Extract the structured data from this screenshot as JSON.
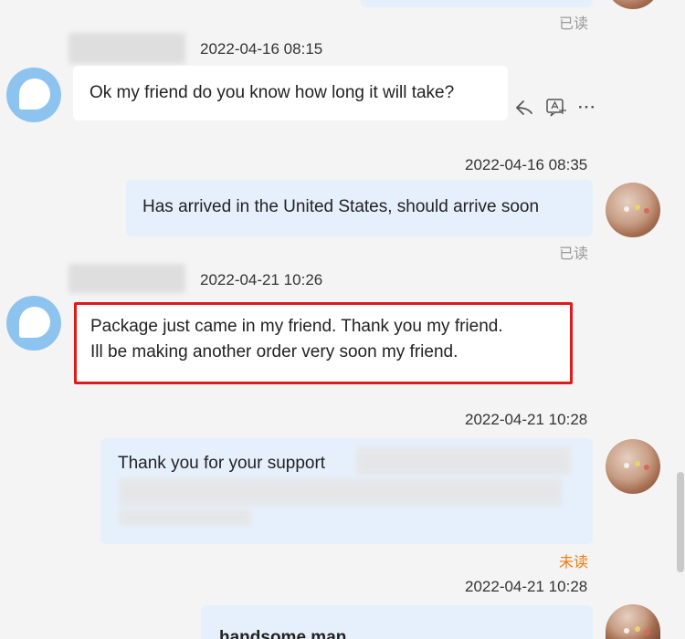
{
  "messages": [
    {
      "status": "已读"
    },
    {
      "time": "2022-04-16 08:15",
      "text": "Ok my friend do you know how long it will take?"
    },
    {
      "time": "2022-04-16 08:35",
      "text": "Has arrived in the United States, should arrive soon",
      "status": "已读"
    },
    {
      "time": "2022-04-21 10:26",
      "line1": "Package just came in my friend. Thank you my friend.",
      "line2": "Ill be making another order very soon my friend."
    },
    {
      "time": "2022-04-21 10:28",
      "text": "Thank you for your support",
      "status": "未读"
    },
    {
      "time": "2022-04-21 10:28",
      "text": "handsome man"
    }
  ],
  "actions": {
    "reply_icon": "reply-icon",
    "translate_icon": "translate-icon",
    "more_icon": "more-icon",
    "more_glyph": "···"
  },
  "colors": {
    "highlight": "#e0191b",
    "unread": "#f07b12",
    "my_bubble": "#e6f0fc",
    "bot_avatar": "#8cc4ef"
  }
}
